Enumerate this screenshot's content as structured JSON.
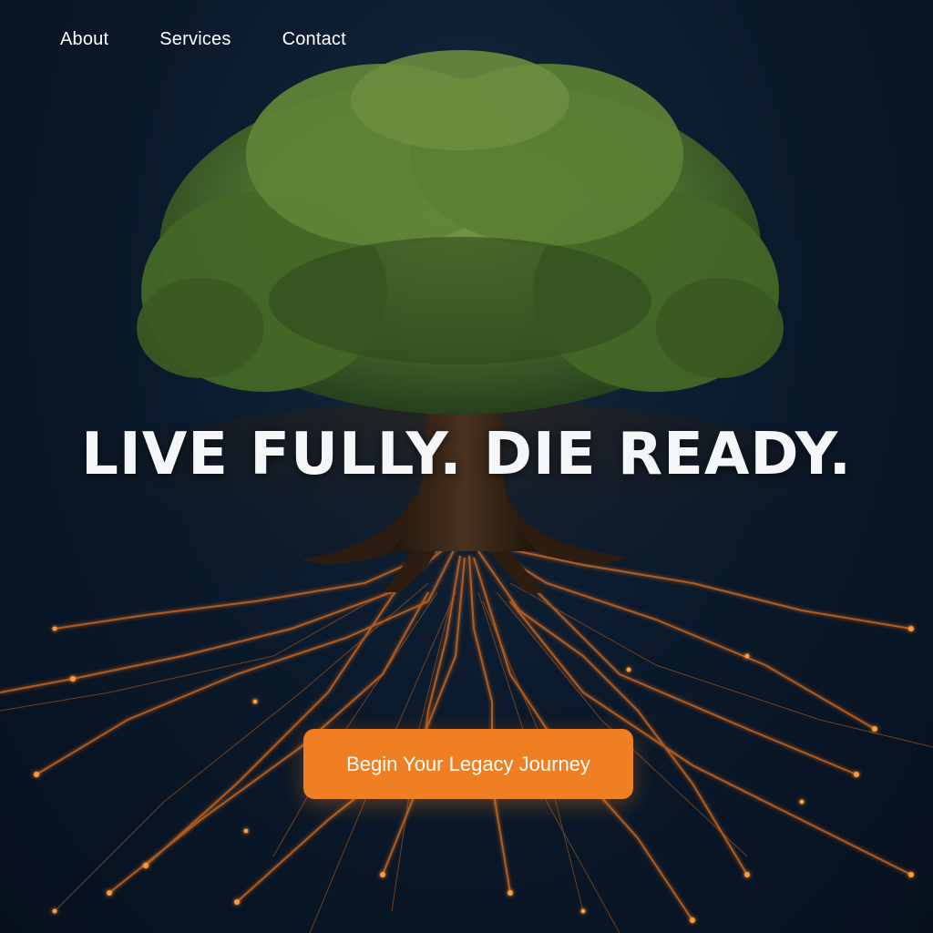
{
  "nav": {
    "items": [
      {
        "label": "About"
      },
      {
        "label": "Services"
      },
      {
        "label": "Contact"
      }
    ]
  },
  "hero": {
    "headline": "LIVE FULLY. DIE READY.",
    "image": "tree-with-circuit-roots",
    "cta_label": "Begin Your Legacy Journey"
  },
  "colors": {
    "background": "#0b1a2c",
    "accent": "#f07e22",
    "foliage": "#4a6e2a",
    "trunk": "#3a2716",
    "circuit_glow": "#ff8a2a",
    "text": "#ffffff"
  }
}
